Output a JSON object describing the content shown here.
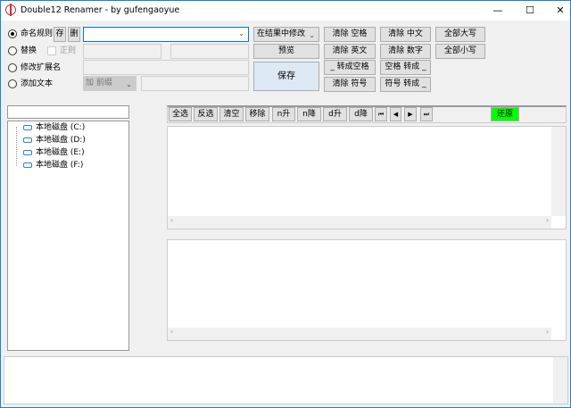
{
  "window": {
    "title": "Double12 Renamer - by gufengaoyue",
    "minimize": "—",
    "maximize": "☐",
    "close": "✕"
  },
  "options": {
    "naming_rule": "命名规则",
    "save_rule": "存",
    "delete_rule": "删",
    "replace": "替换",
    "regex": "正则",
    "change_ext": "修改扩展名",
    "add_text": "添加文本",
    "add_position": "加 前缀",
    "mode_select": "在结果中修改",
    "preview": "预览",
    "save": "保存"
  },
  "quick_buttons": [
    [
      "清除 空格",
      "清除 中文",
      "全部大写"
    ],
    [
      "清除 英文",
      "清除 数字",
      "全部小写"
    ],
    [
      "_ 转成空格",
      "空格 转成 _"
    ],
    [
      "清除 符号",
      "符号 转成 _"
    ]
  ],
  "toolbar": {
    "select_all": "全选",
    "invert": "反选",
    "clear": "清空",
    "remove": "移除",
    "name_asc": "n升",
    "name_desc": "n降",
    "date_asc": "d升",
    "date_desc": "d降",
    "restore": "还原",
    "restore_color": "#00ff00"
  },
  "tree": {
    "drives": [
      "本地磁盘 (C:)",
      "本地磁盘 (D:)",
      "本地磁盘 (E:)",
      "本地磁盘 (F:)"
    ]
  }
}
